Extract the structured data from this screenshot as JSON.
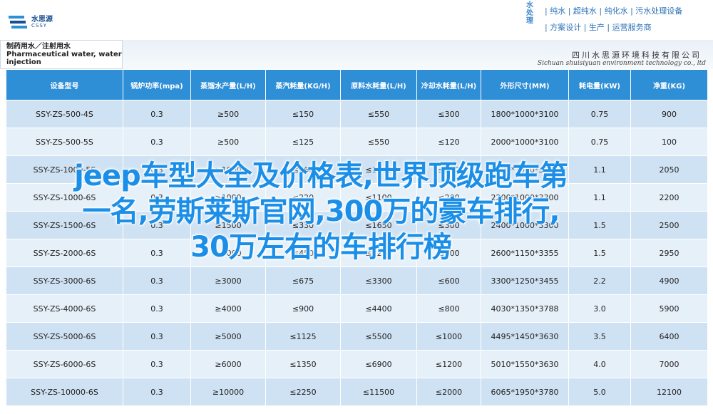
{
  "header": {
    "logo_cn": "水思源",
    "logo_en": "CSSY",
    "vertical_text": "水处理",
    "services": [
      "| 纯水 | 超纯水 | 纯化水 | 污水处理设备",
      "| 方案设计 | 生产 | 运营服务商"
    ]
  },
  "banner": {
    "product_title_lines": [
      "制药用水／注射用水",
      "Pharmaceutical water, water for",
      "injection"
    ],
    "company_cn": "四川水思源环境科技有限公司",
    "company_en": "Sichuan shuisiyuan environment technology co., ltd"
  },
  "table": {
    "headers": [
      "设备型号",
      "锅炉功率(mpa)",
      "蒸馏水产量(L/H)",
      "蒸汽耗量(KG/H)",
      "原料水耗量(L/H)",
      "冷却水耗量(L/H)",
      "外形尺寸(MM)",
      "耗电量(KW)",
      "净重(KG)"
    ],
    "rows": [
      [
        "SSY-ZS-500-4S",
        "0.3",
        "≥500",
        "≤150",
        "≤550",
        "≤300",
        "1800*1000*3100",
        "0.75",
        "900"
      ],
      [
        "SSY-ZS-500-5S",
        "0.3",
        "≥500",
        "≤125",
        "≤550",
        "≤120",
        "2000*1000*3100",
        "0.75",
        "100"
      ],
      [
        "SSY-ZS-1000-5S",
        "0.3",
        "≥1000",
        "≤260",
        "≤1100",
        "≤250",
        "2000*1000*3300",
        "1.1",
        "2050"
      ],
      [
        "SSY-ZS-1000-6S",
        "0.3",
        "≥1000",
        "≤220",
        "≤1100",
        "≤200",
        "2200*1000*3300",
        "1.1",
        "2200"
      ],
      [
        "SSY-ZS-1500-6S",
        "0.3",
        "≥1500",
        "≤330",
        "≤1650",
        "≤300",
        "2400*1000*3300",
        "1.5",
        "2500"
      ],
      [
        "SSY-ZS-2000-6S",
        "0.3",
        "≥2000",
        "≤450",
        "≤2200",
        "≤400",
        "2600*1150*3355",
        "1.5",
        "2950"
      ],
      [
        "SSY-ZS-3000-6S",
        "0.3",
        "≥3000",
        "≤675",
        "≤3300",
        "≤600",
        "3300*1250*3455",
        "2.2",
        "4900"
      ],
      [
        "SSY-ZS-4000-6S",
        "0.3",
        "≥4000",
        "≤900",
        "≤4400",
        "≤800",
        "4030*1350*3788",
        "3.0",
        "5900"
      ],
      [
        "SSY-ZS-5000-6S",
        "0.3",
        "≥5000",
        "≤1125",
        "≤5500",
        "≤1000",
        "4495*1450*3630",
        "3.5",
        "6400"
      ],
      [
        "SSY-ZS-6000-6S",
        "0.3",
        "≥6000",
        "≤1350",
        "≤6900",
        "≤1200",
        "5010*1550*3630",
        "4.0",
        "7000"
      ],
      [
        "SSY-ZS-10000-6S",
        "0.3",
        "≥10000",
        "≤2250",
        "≤11500",
        "≤2000",
        "6065*1950*3780",
        "5.0",
        "12100"
      ]
    ]
  },
  "overlay": {
    "lines": [
      "jeep车型大全及价格表,世界顶级跑车第",
      "一名,劳斯莱斯官网,300万的豪车排行,",
      "30万左右的车排行榜"
    ]
  },
  "colors": {
    "header_blue": "#2e8ed6",
    "row_odd": "#cfe2f3",
    "row_even": "#e6f0f9",
    "overlay_blue": "#1b8fe8"
  }
}
